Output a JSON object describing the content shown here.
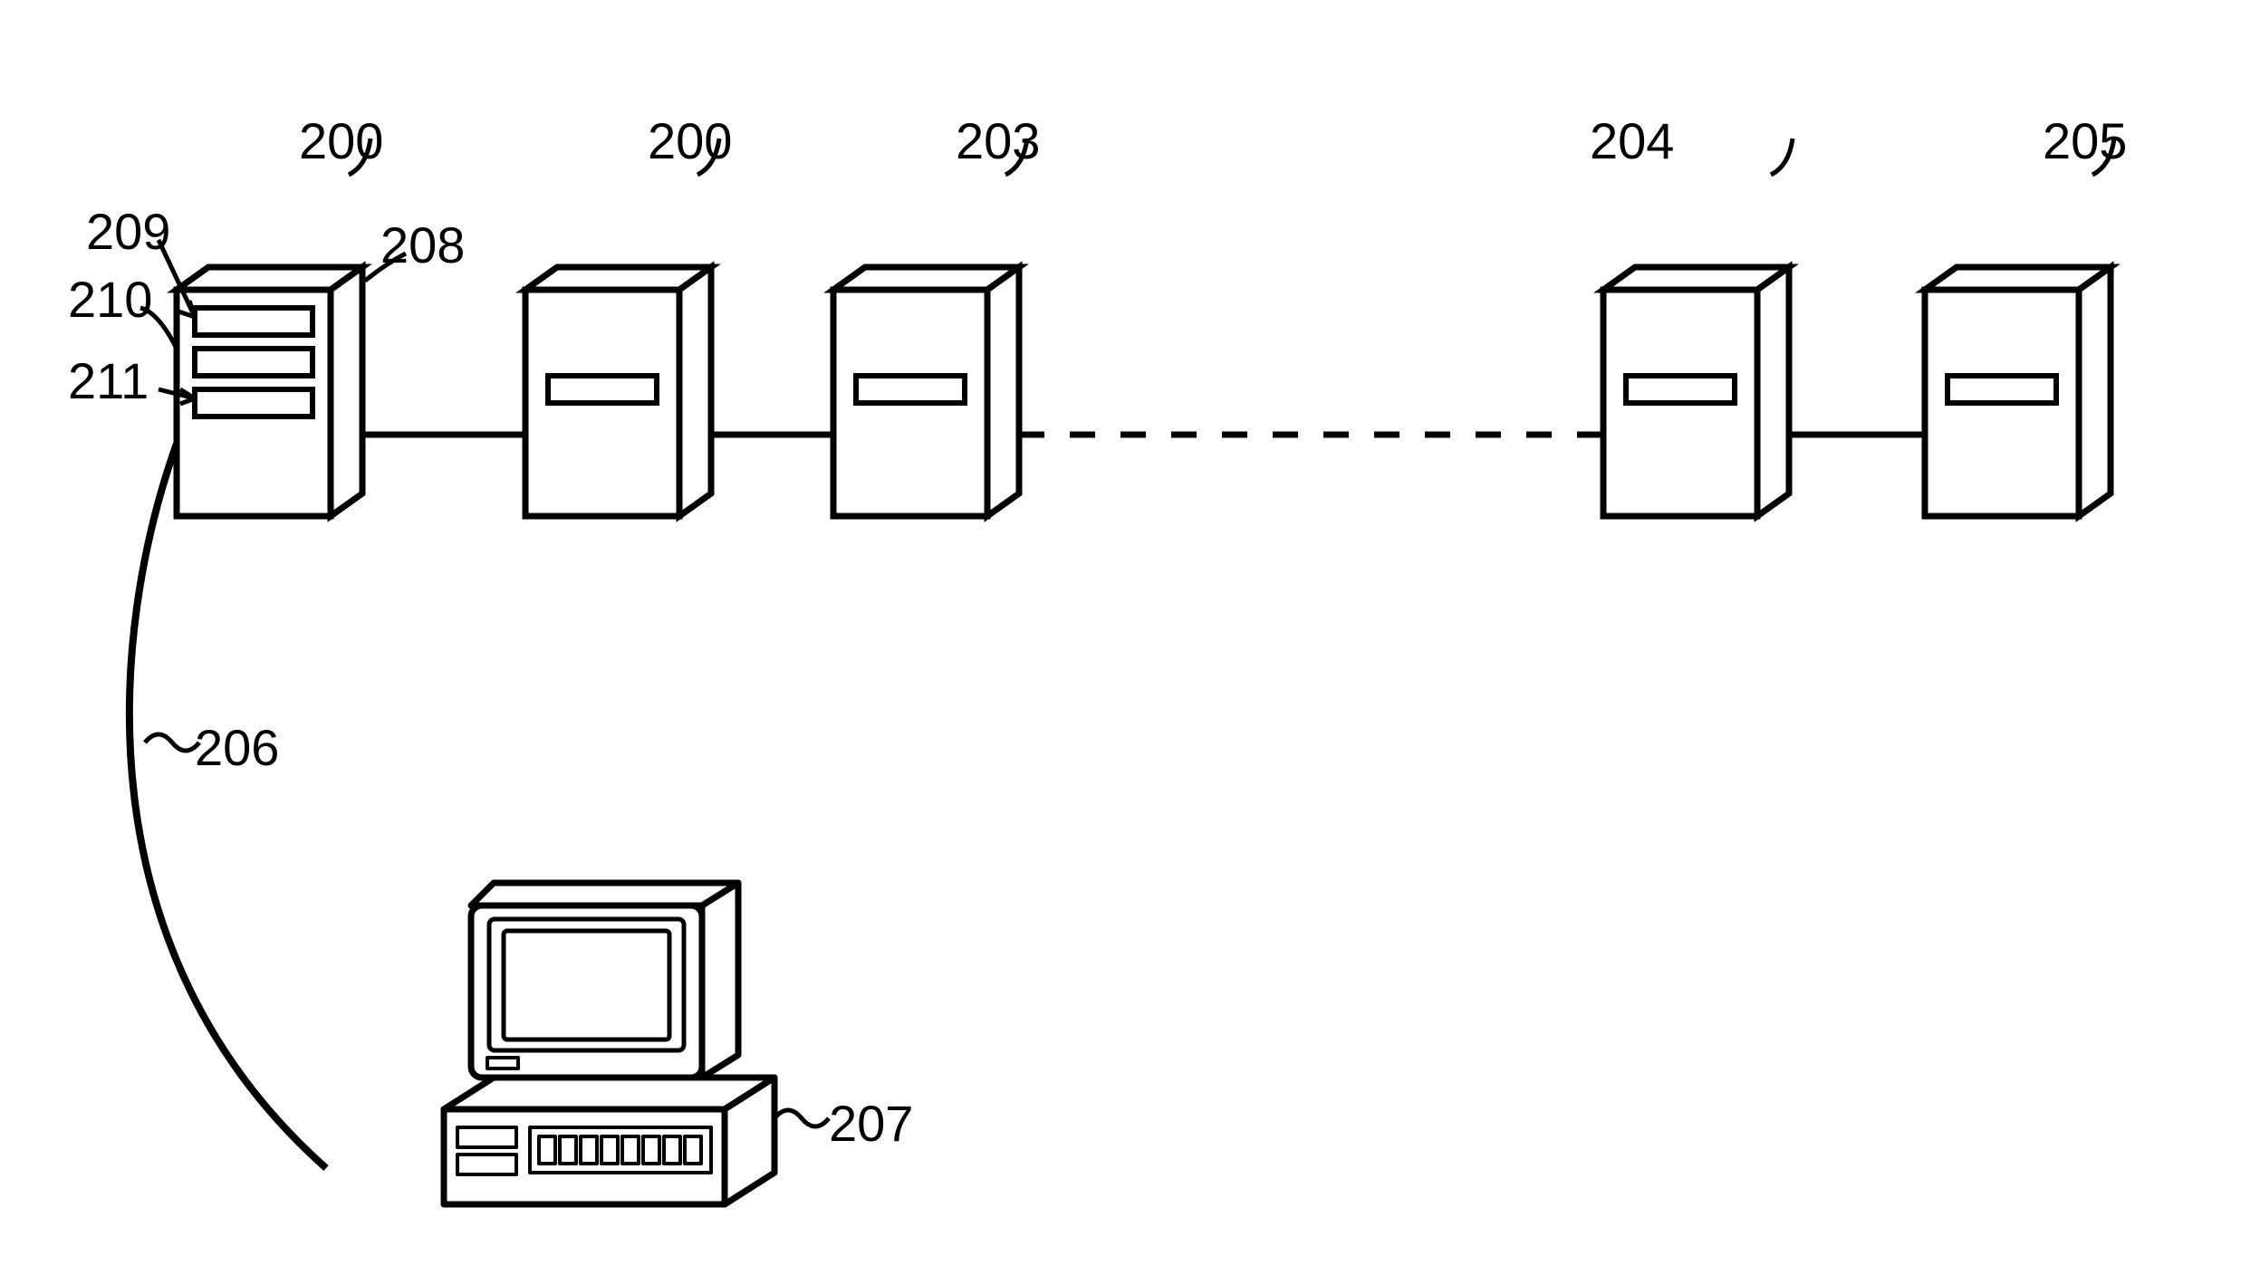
{
  "labels": {
    "l200a": "200",
    "l200b": "200",
    "l203": "203",
    "l204": "204",
    "l205": "205",
    "l206": "206",
    "l207": "207",
    "l208": "208",
    "l209": "209",
    "l210": "210",
    "l211": "211"
  }
}
